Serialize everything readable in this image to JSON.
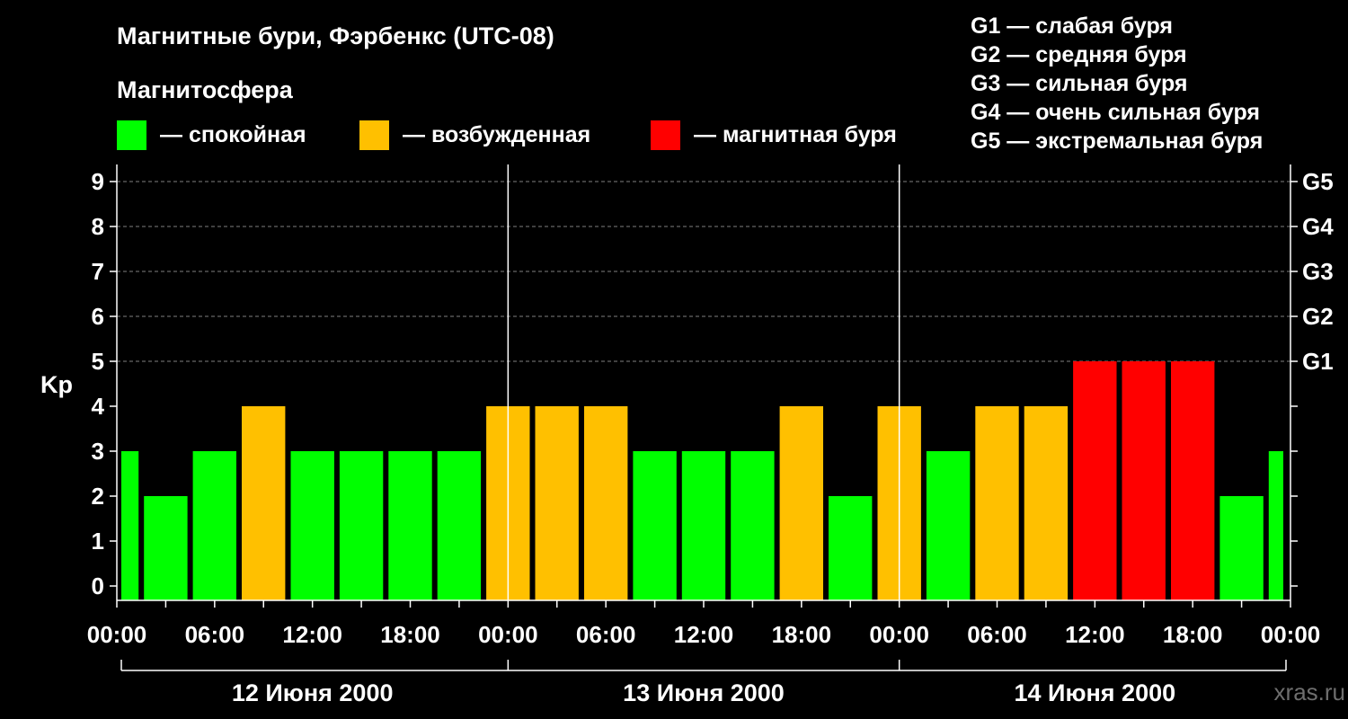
{
  "title": "Магнитные бури, Фэрбенкс (UTC-08)",
  "magnetosphere_label": "Магнитосфера",
  "legend": [
    {
      "label": "— спокойная",
      "color": "#00ff00"
    },
    {
      "label": "— возбужденная",
      "color": "#ffc000"
    },
    {
      "label": "— магнитная буря",
      "color": "#ff0000"
    }
  ],
  "g_scale": [
    "G1 — слабая буря",
    "G2 — средняя буря",
    "G3 — сильная буря",
    "G4 — очень сильная буря",
    "G5 — экстремальная буря"
  ],
  "brand": "xras.ru",
  "colors": {
    "background": "#000000",
    "axis": "#ffffff",
    "grid": "#808080"
  },
  "chart_data": {
    "type": "bar",
    "ylabel": "Kp",
    "ylim": [
      0,
      9
    ],
    "y_ticks": [
      "0",
      "1",
      "2",
      "3",
      "4",
      "5",
      "6",
      "7",
      "8",
      "9"
    ],
    "right_ticks": [
      {
        "kp": 5,
        "label": "G1"
      },
      {
        "kp": 6,
        "label": "G2"
      },
      {
        "kp": 7,
        "label": "G3"
      },
      {
        "kp": 8,
        "label": "G4"
      },
      {
        "kp": 9,
        "label": "G5"
      }
    ],
    "x_ticks": [
      "00:00",
      "06:00",
      "12:00",
      "18:00",
      "00:00",
      "06:00",
      "12:00",
      "18:00",
      "00:00",
      "06:00",
      "12:00",
      "18:00",
      "00:00"
    ],
    "days": [
      "12 Июня 2000",
      "13 Июня 2000",
      "14 Июня 2000"
    ],
    "bars": [
      {
        "kp": 3,
        "level": "quiet"
      },
      {
        "kp": 2,
        "level": "quiet"
      },
      {
        "kp": 3,
        "level": "quiet"
      },
      {
        "kp": 4,
        "level": "active"
      },
      {
        "kp": 3,
        "level": "quiet"
      },
      {
        "kp": 3,
        "level": "quiet"
      },
      {
        "kp": 3,
        "level": "quiet"
      },
      {
        "kp": 3,
        "level": "quiet"
      },
      {
        "kp": 4,
        "level": "active"
      },
      {
        "kp": 4,
        "level": "active"
      },
      {
        "kp": 4,
        "level": "active"
      },
      {
        "kp": 3,
        "level": "quiet"
      },
      {
        "kp": 3,
        "level": "quiet"
      },
      {
        "kp": 3,
        "level": "quiet"
      },
      {
        "kp": 4,
        "level": "active"
      },
      {
        "kp": 2,
        "level": "quiet"
      },
      {
        "kp": 4,
        "level": "active"
      },
      {
        "kp": 3,
        "level": "quiet"
      },
      {
        "kp": 4,
        "level": "active"
      },
      {
        "kp": 4,
        "level": "active"
      },
      {
        "kp": 5,
        "level": "storm"
      },
      {
        "kp": 5,
        "level": "storm"
      },
      {
        "kp": 5,
        "level": "storm"
      },
      {
        "kp": 2,
        "level": "quiet"
      },
      {
        "kp": 3,
        "level": "quiet"
      }
    ],
    "level_colors": {
      "quiet": "#00ff00",
      "active": "#ffc000",
      "storm": "#ff0000"
    },
    "grid": true
  }
}
